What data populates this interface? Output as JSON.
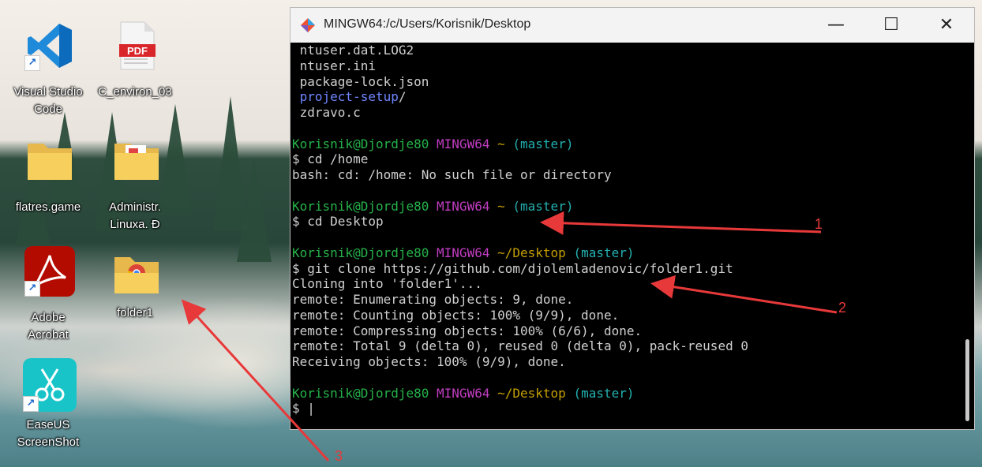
{
  "window": {
    "title": "MINGW64:/c/Users/Korisnik/Desktop",
    "controls": {
      "minimize": "—",
      "maximize": "☐",
      "close": "✕"
    }
  },
  "terminal": {
    "lines": [
      [
        {
          "t": " ntuser.dat.LOG2",
          "c": "w"
        }
      ],
      [
        {
          "t": " ntuser.ini",
          "c": "w"
        }
      ],
      [
        {
          "t": " package-lock.json",
          "c": "w"
        }
      ],
      [
        {
          "t": " project-setup",
          "c": "b"
        },
        {
          "t": "/",
          "c": "w"
        }
      ],
      [
        {
          "t": " zdravo.c",
          "c": "w"
        }
      ],
      [],
      [
        {
          "t": "Korisnik@Djordje80",
          "c": "g"
        },
        {
          "t": " ",
          "c": "w"
        },
        {
          "t": "MINGW64",
          "c": "m"
        },
        {
          "t": " ",
          "c": "w"
        },
        {
          "t": "~",
          "c": "y"
        },
        {
          "t": " ",
          "c": "w"
        },
        {
          "t": "(master)",
          "c": "c"
        }
      ],
      [
        {
          "t": "$ cd /home",
          "c": "w"
        }
      ],
      [
        {
          "t": "bash: cd: /home: No such file or directory",
          "c": "w"
        }
      ],
      [],
      [
        {
          "t": "Korisnik@Djordje80",
          "c": "g"
        },
        {
          "t": " ",
          "c": "w"
        },
        {
          "t": "MINGW64",
          "c": "m"
        },
        {
          "t": " ",
          "c": "w"
        },
        {
          "t": "~",
          "c": "y"
        },
        {
          "t": " ",
          "c": "w"
        },
        {
          "t": "(master)",
          "c": "c"
        }
      ],
      [
        {
          "t": "$ cd Desktop",
          "c": "w"
        }
      ],
      [],
      [
        {
          "t": "Korisnik@Djordje80",
          "c": "g"
        },
        {
          "t": " ",
          "c": "w"
        },
        {
          "t": "MINGW64",
          "c": "m"
        },
        {
          "t": " ",
          "c": "w"
        },
        {
          "t": "~/Desktop",
          "c": "y"
        },
        {
          "t": " ",
          "c": "w"
        },
        {
          "t": "(master)",
          "c": "c"
        }
      ],
      [
        {
          "t": "$ git clone https://github.com/djolemladenovic/folder1.git",
          "c": "w"
        }
      ],
      [
        {
          "t": "Cloning into 'folder1'...",
          "c": "w"
        }
      ],
      [
        {
          "t": "remote: Enumerating objects: 9, done.",
          "c": "w"
        }
      ],
      [
        {
          "t": "remote: Counting objects: 100% (9/9), done.",
          "c": "w"
        }
      ],
      [
        {
          "t": "remote: Compressing objects: 100% (6/6), done.",
          "c": "w"
        }
      ],
      [
        {
          "t": "remote: Total 9 (delta 0), reused 0 (delta 0), pack-reused 0",
          "c": "w"
        }
      ],
      [
        {
          "t": "Receiving objects: 100% (9/9), done.",
          "c": "w"
        }
      ],
      [],
      [
        {
          "t": "Korisnik@Djordje80",
          "c": "g"
        },
        {
          "t": " ",
          "c": "w"
        },
        {
          "t": "MINGW64",
          "c": "m"
        },
        {
          "t": " ",
          "c": "w"
        },
        {
          "t": "~/Desktop",
          "c": "y"
        },
        {
          "t": " ",
          "c": "w"
        },
        {
          "t": "(master)",
          "c": "c"
        }
      ],
      [
        {
          "t": "$ |",
          "c": "w"
        }
      ]
    ]
  },
  "desktop": {
    "icons": [
      {
        "label1": "Visual Studio",
        "label2": "Code",
        "icon": "vscode-icon"
      },
      {
        "label1": "C_environ_03",
        "label2": "",
        "icon": "pdf-icon",
        "badge": "PDF"
      },
      {
        "label1": "flatres.game",
        "label2": "",
        "icon": "folder-icon"
      },
      {
        "label1": "Administr.",
        "label2": "Linuxa. Đ",
        "icon": "folder-icon"
      },
      {
        "label1": "Adobe",
        "label2": "Acrobat",
        "icon": "acrobat-icon"
      },
      {
        "label1": "folder1",
        "label2": "",
        "icon": "folder-icon"
      },
      {
        "label1": "EaseUS",
        "label2": "ScreenShot",
        "icon": "easeus-screenshot-icon"
      }
    ]
  },
  "annotations": {
    "n1": "1",
    "n2": "2",
    "n3": "3"
  },
  "colors": {
    "prompt_user": "#26b34a",
    "prompt_host": "#c23ec2",
    "prompt_path": "#c4a000",
    "prompt_branch": "#24b0b0",
    "dir": "#6f86ff",
    "arrow": "#e8393a"
  }
}
